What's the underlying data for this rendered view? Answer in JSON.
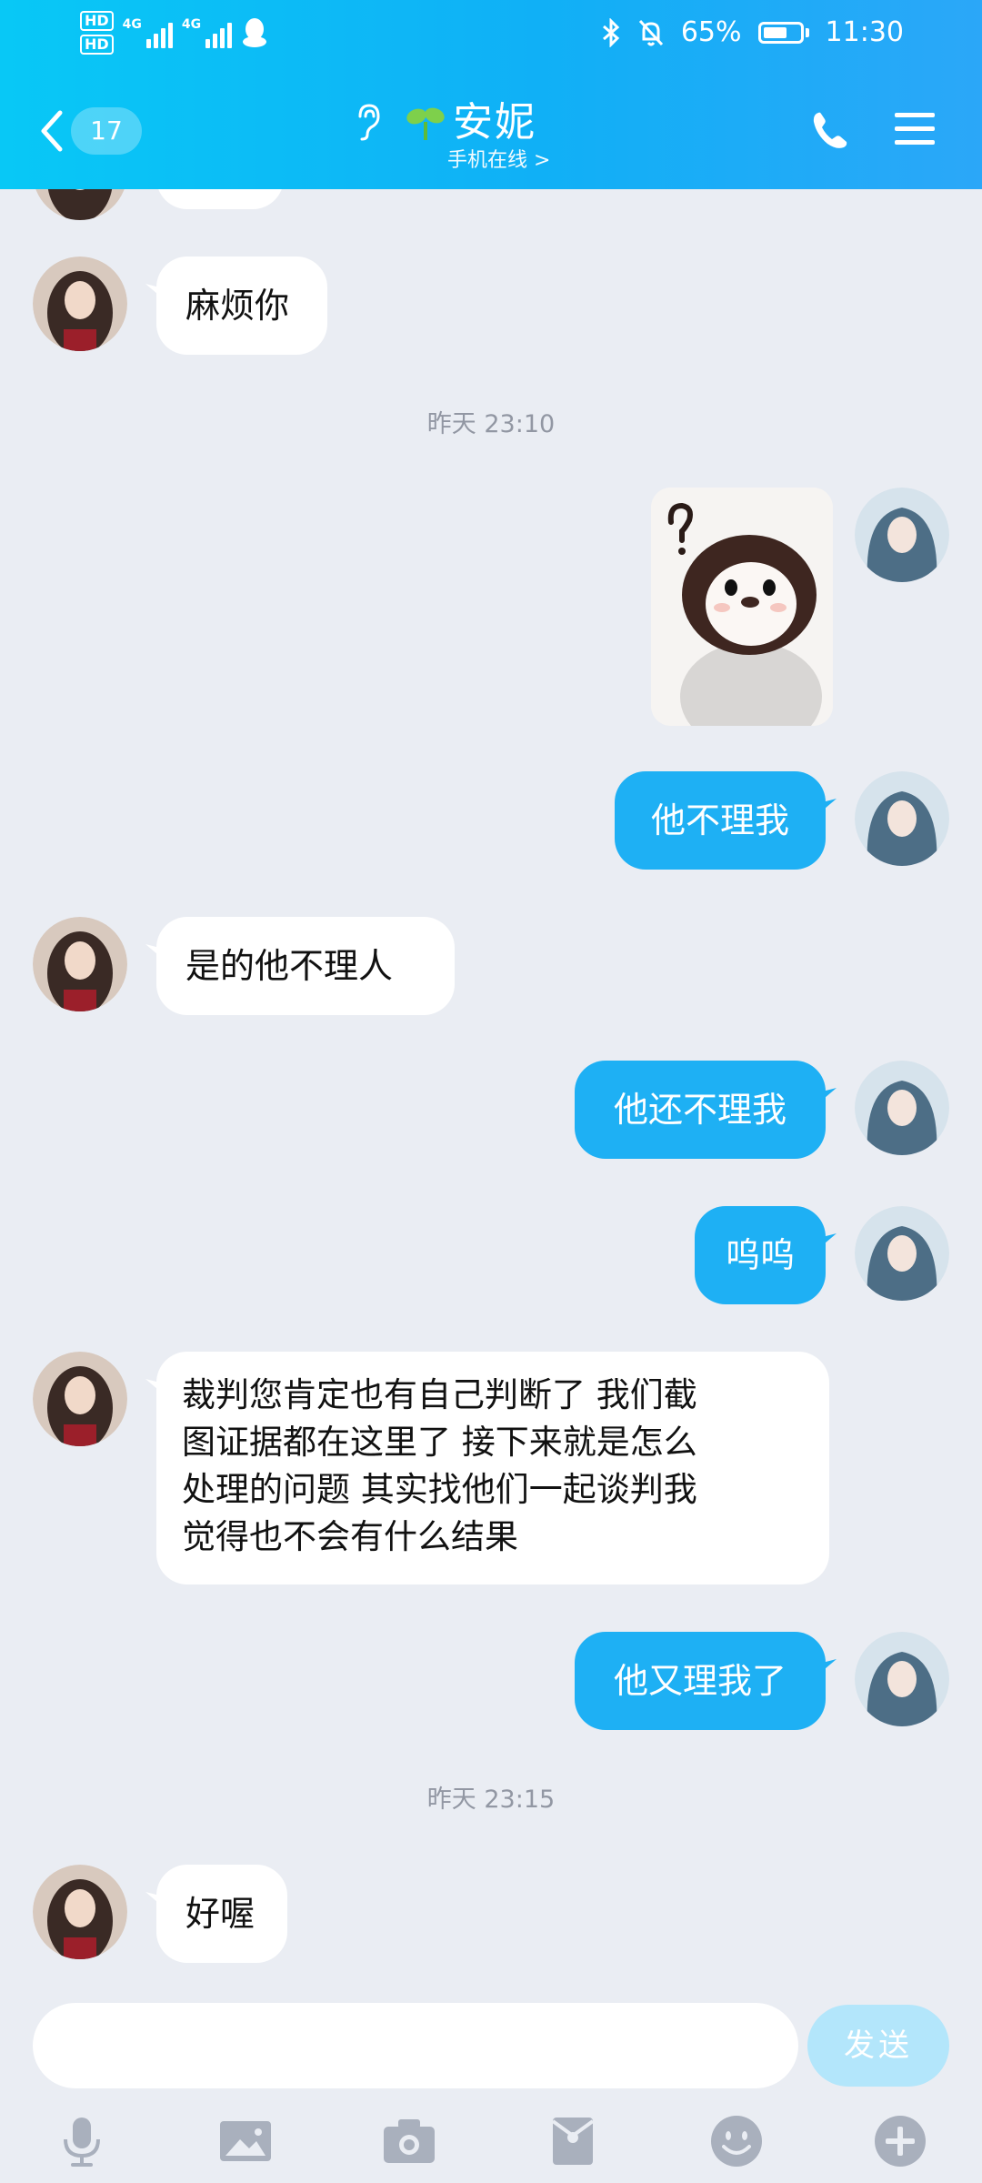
{
  "status_bar": {
    "hd1": "HD",
    "hd2": "HD",
    "net1": "4G",
    "net2": "4G",
    "battery_pct": "65%",
    "battery_level": 0.65,
    "time": "11:30"
  },
  "header": {
    "unread_count": "17",
    "contact_name": "安妮",
    "contact_status": "手机在线 >",
    "icons": [
      "back-chevron-icon",
      "ear-icon",
      "sprout-icon",
      "phone-icon",
      "menu-icon"
    ]
  },
  "chat": {
    "timestamps": [
      "昨天 23:10",
      "昨天 23:15"
    ],
    "messages": [
      {
        "dir": "in",
        "text": "麻烦你"
      },
      {
        "dir": "out",
        "type": "sticker",
        "sticker": "penguin-question-sticker"
      },
      {
        "dir": "out",
        "text": "他不理我"
      },
      {
        "dir": "in",
        "text": "是的他不理人"
      },
      {
        "dir": "out",
        "text": "他还不理我"
      },
      {
        "dir": "out",
        "text": "呜呜"
      },
      {
        "dir": "in",
        "lines": [
          "裁判您肯定也有自己判断了 我们截",
          "图证据都在这里了 接下来就是怎么",
          "处理的问题 其实找他们一起谈判我",
          "觉得也不会有什么结果"
        ]
      },
      {
        "dir": "out",
        "text": "他又理我了"
      },
      {
        "dir": "in",
        "text": "好喔"
      }
    ]
  },
  "composer": {
    "input_value": "",
    "send_label": "发送",
    "tools": [
      "microphone-icon",
      "image-icon",
      "camera-icon",
      "red-packet-icon",
      "emoji-icon",
      "plus-icon"
    ]
  },
  "colors": {
    "header_gradient_start": "#08C8F6",
    "header_gradient_end": "#2BA7F8",
    "outgoing_bubble": "#1EB0F4",
    "incoming_bubble": "#FFFFFF",
    "chat_background": "#EAEDF3",
    "send_button_disabled": "#B3E6FB",
    "toolbar_icon": "#A9B0BD"
  }
}
